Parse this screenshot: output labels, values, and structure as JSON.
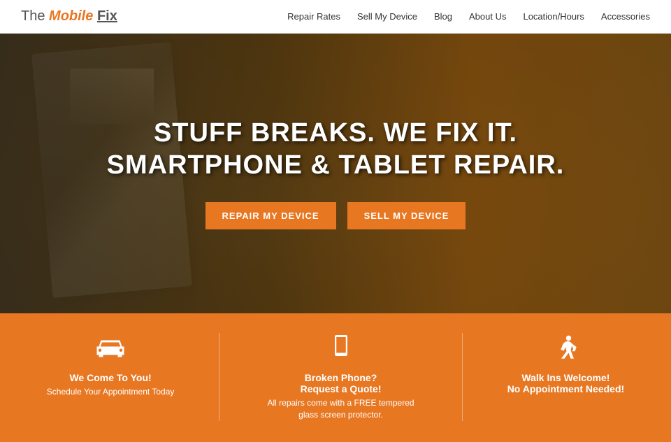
{
  "site": {
    "logo": {
      "the": "The",
      "mobile": "Mobile",
      "fix": "Fix"
    }
  },
  "nav": {
    "items": [
      {
        "label": "Repair Rates",
        "id": "repair-rates"
      },
      {
        "label": "Sell My Device",
        "id": "sell-my-device"
      },
      {
        "label": "Blog",
        "id": "blog"
      },
      {
        "label": "About Us",
        "id": "about-us"
      },
      {
        "label": "Location/Hours",
        "id": "location-hours"
      },
      {
        "label": "Accessories",
        "id": "accessories"
      }
    ]
  },
  "hero": {
    "title_line1": "STUFF BREAKS. WE FIX IT.",
    "title_line2": "SMARTPHONE & TABLET REPAIR.",
    "btn1": "REPAIR MY DEVICE",
    "btn2": "SELL MY DEVICE"
  },
  "features": [
    {
      "id": "we-come-to-you",
      "icon": "car",
      "title": "We Come To You!",
      "subtitle": "Schedule Your Appointment Today",
      "desc": ""
    },
    {
      "id": "broken-phone",
      "icon": "phone",
      "title": "Broken Phone?",
      "subtitle": "Request a Quote!",
      "desc": "All repairs come with a FREE tempered glass screen protector."
    },
    {
      "id": "walk-ins",
      "icon": "walk",
      "title": "Walk Ins Welcome!",
      "subtitle": "No Appointment Needed!",
      "desc": ""
    }
  ]
}
